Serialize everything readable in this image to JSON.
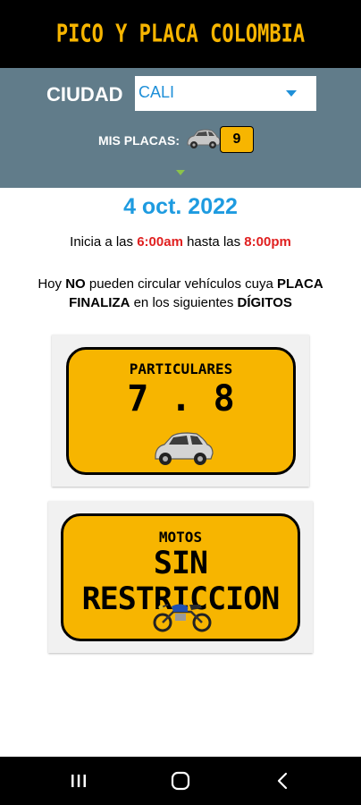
{
  "header": {
    "title": "PICO Y PLACA COLOMBIA"
  },
  "city": {
    "label": "CIUDAD",
    "selected": "CALI"
  },
  "plates": {
    "label": "MIS PLACAS:",
    "digit": "9"
  },
  "date": "4 oct. 2022",
  "schedule": {
    "prefix": "Inicia a las",
    "start": "6:00am",
    "middle": "hasta las",
    "end": "8:00pm"
  },
  "notice": {
    "p1": "Hoy ",
    "no": "NO",
    "p2": " pueden circular vehículos cuya ",
    "placa": "PLACA",
    "finaliza": "FINALIZA",
    "p3": " en los siguientes ",
    "digitos": "DÍGITOS"
  },
  "cards": [
    {
      "title": "PARTICULARES",
      "value": "7 . 8",
      "icon": "car-icon"
    },
    {
      "title": "MOTOS",
      "value": "SIN RESTRICCION",
      "icon": "motorcycle-icon"
    }
  ],
  "nav": {
    "icons": [
      "recents-icon",
      "home-icon",
      "back-icon"
    ]
  },
  "colors": {
    "accent": "#f7b500",
    "panel": "#617c8a",
    "date": "#1e9be0",
    "time": "#e02020"
  }
}
